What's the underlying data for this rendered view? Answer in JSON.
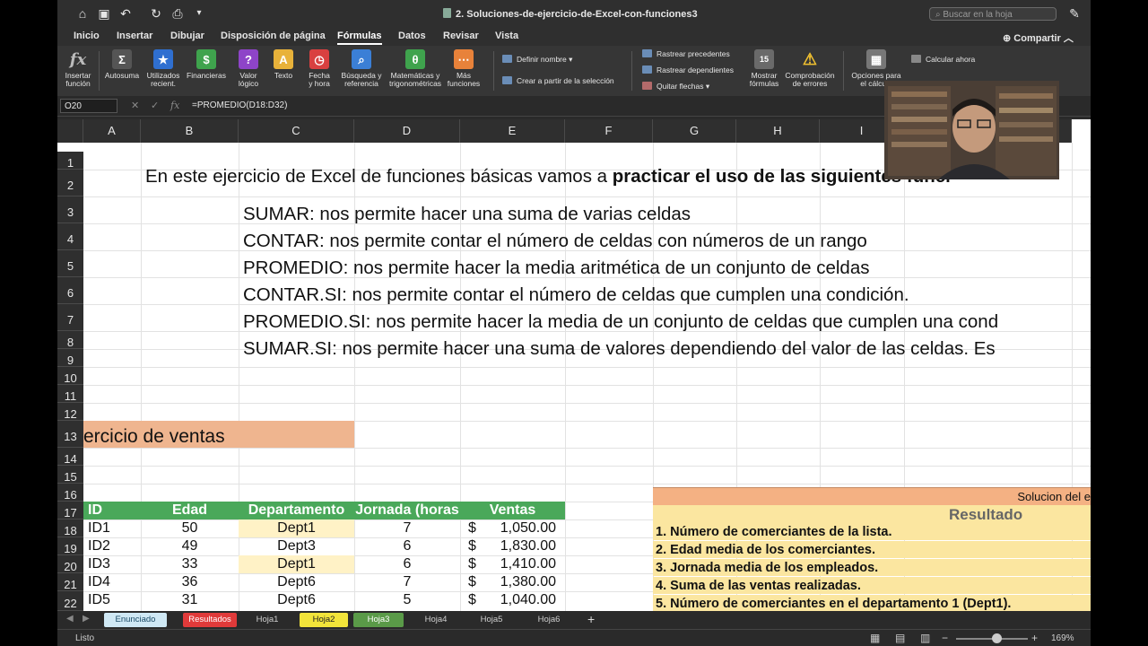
{
  "window": {
    "title": "2. Soluciones-de-ejercicio-de-Excel-con-funciones3",
    "search_placeholder": "Buscar en la hoja"
  },
  "menu": {
    "items": [
      "Inicio",
      "Insertar",
      "Dibujar",
      "Disposición de página",
      "Fórmulas",
      "Datos",
      "Revisar",
      "Vista"
    ],
    "active": "Fórmulas",
    "share": "Compartir"
  },
  "ribbon": {
    "insert_function": "Insertar\nfunción",
    "buttons": [
      {
        "label": "Autosuma",
        "icon": "sigma-icon",
        "color": "#555555",
        "glyph": "Σ"
      },
      {
        "label": "Utilizados\nrecient.",
        "icon": "star-icon",
        "color": "#2f6fd0",
        "glyph": "★"
      },
      {
        "label": "Financieras",
        "icon": "financial-icon",
        "color": "#3fa34d",
        "glyph": "$"
      },
      {
        "label": "Valor\nlógico",
        "icon": "logical-icon",
        "color": "#8e44c8",
        "glyph": "?"
      },
      {
        "label": "Texto",
        "icon": "text-icon",
        "color": "#e8b23a",
        "glyph": "A"
      },
      {
        "label": "Fecha\ny hora",
        "icon": "clock-icon",
        "color": "#d94040",
        "glyph": "◷"
      },
      {
        "label": "Búsqueda y\nreferencia",
        "icon": "lookup-icon",
        "color": "#3b7fd6",
        "glyph": "⌕"
      },
      {
        "label": "Matemáticas y\ntrigonométricas",
        "icon": "math-icon",
        "color": "#3fa34d",
        "glyph": "θ"
      },
      {
        "label": "Más\nfunciones",
        "icon": "more-functions-icon",
        "color": "#e8823a",
        "glyph": "⋯"
      }
    ],
    "define_name": "Definir nombre",
    "create_from_selection": "Crear a partir de la selección",
    "trace_precedents": "Rastrear precedentes",
    "trace_dependents": "Rastrear dependientes",
    "remove_arrows": "Quitar flechas",
    "show_formulas": "Mostrar\nfórmulas",
    "error_checking": "Comprobación\nde errores",
    "calc_options": "Opciones para\nel cálculo",
    "calculate_now": "Calcular ahora"
  },
  "formula_bar": {
    "name_box": "O20",
    "formula": "=PROMEDIO(D18:D32)"
  },
  "columns": [
    "A",
    "B",
    "C",
    "D",
    "E",
    "F",
    "G",
    "H",
    "I"
  ],
  "rows": [
    "1",
    "2",
    "3",
    "4",
    "5",
    "6",
    "7",
    "8",
    "9",
    "10",
    "11",
    "12",
    "13",
    "14",
    "15",
    "16",
    "17",
    "18",
    "19",
    "20",
    "21",
    "22"
  ],
  "sheet": {
    "intro_normal": "En este ejercicio de Excel de funciones básicas vamos a ",
    "intro_bold": "practicar el uso de las siguientes funci",
    "functions": [
      "SUMAR: nos permite hacer una suma de varias celdas",
      "CONTAR: nos permite contar el número de celdas con números de un rango",
      "PROMEDIO: nos permite hacer la media aritmética de un conjunto de celdas",
      "CONTAR.SI: nos permite contar el número de celdas que cumplen una condición.",
      "PROMEDIO.SI: nos permite hacer la media de un conjunto de celdas que cumplen una cond",
      "SUMAR.SI: nos permite hacer una suma de valores dependiendo del valor de las celdas. Es"
    ],
    "section_title": "ercicio de ventas",
    "table_headers": [
      "ID",
      "Edad",
      "Departamento",
      "Jornada (horas",
      "Ventas"
    ],
    "table_rows": [
      {
        "id": "ID1",
        "edad": "50",
        "dept": "Dept1",
        "jornada": "7",
        "currency": "$",
        "ventas": "1,050.00",
        "highlight": true
      },
      {
        "id": "ID2",
        "edad": "49",
        "dept": "Dept3",
        "jornada": "6",
        "currency": "$",
        "ventas": "1,830.00",
        "highlight": false
      },
      {
        "id": "ID3",
        "edad": "33",
        "dept": "Dept1",
        "jornada": "6",
        "currency": "$",
        "ventas": "1,410.00",
        "highlight": true
      },
      {
        "id": "ID4",
        "edad": "36",
        "dept": "Dept6",
        "jornada": "7",
        "currency": "$",
        "ventas": "1,380.00",
        "highlight": false
      },
      {
        "id": "ID5",
        "edad": "31",
        "dept": "Dept6",
        "jornada": "5",
        "currency": "$",
        "ventas": "1,040.00",
        "highlight": false
      }
    ],
    "solution_title": "Solucion del e",
    "result_header": "Resultado",
    "questions": [
      "1. Número de comerciantes de la lista.",
      "2. Edad media de los comerciantes.",
      "3. Jornada media de los empleados.",
      "4. Suma de las ventas realizadas.",
      "5. Número de comerciantes en el departamento 1 (Dept1)."
    ]
  },
  "tabs": [
    {
      "label": "Enunciado",
      "bg": "#cfe8f4",
      "fg": "#1a4a66"
    },
    {
      "label": "Resultados",
      "bg": "#e03a3a",
      "fg": "#ffffff"
    },
    {
      "label": "Hoja1",
      "bg": "",
      "fg": "#cfcfcf"
    },
    {
      "label": "Hoja2",
      "bg": "#f2e43a",
      "fg": "#222222"
    },
    {
      "label": "Hoja3",
      "bg": "#5a9a48",
      "fg": "#ffffff"
    },
    {
      "label": "Hoja4",
      "bg": "",
      "fg": "#cfcfcf"
    },
    {
      "label": "Hoja5",
      "bg": "",
      "fg": "#cfcfcf"
    },
    {
      "label": "Hoja6",
      "bg": "",
      "fg": "#cfcfcf"
    }
  ],
  "status": {
    "text": "Listo",
    "zoom": "169%"
  }
}
